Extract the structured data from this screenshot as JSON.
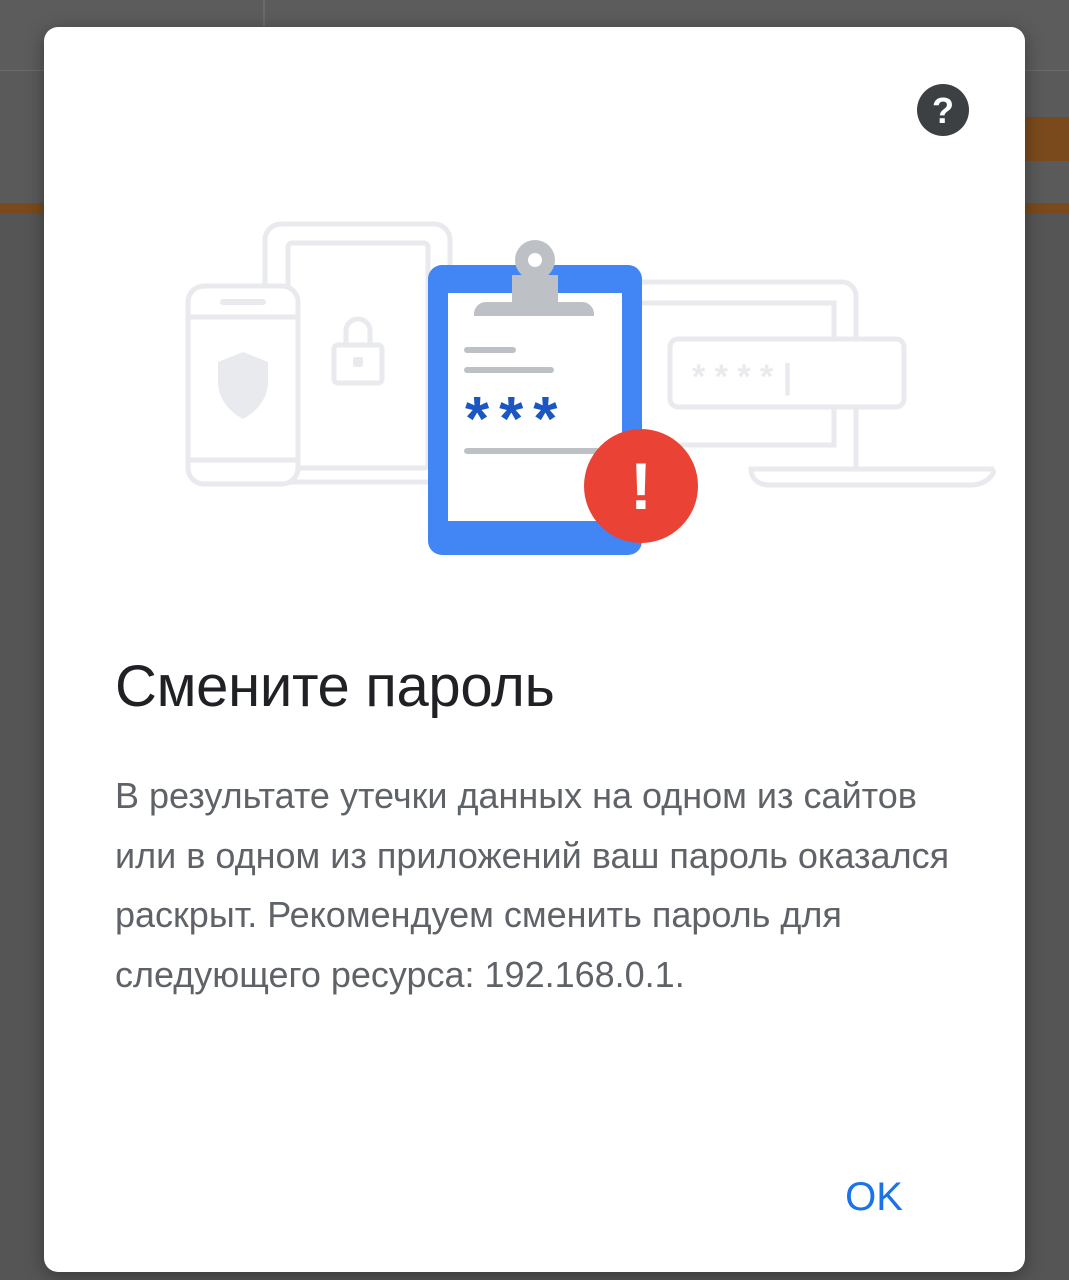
{
  "dialog": {
    "title": "Смените пароль",
    "message": "В результате утечки данных на одном из сайтов или в одном из приложений ваш пароль оказался раскрыт. Рекомендуем сменить пароль для следующего ресурса: 192.168.0.1.",
    "ok_label": "OK",
    "help_icon": "help-icon",
    "illustration": {
      "password_mask": "* * * * |",
      "clipboard_mask": "***",
      "alert_glyph": "!"
    }
  },
  "colors": {
    "accent_blue": "#1a73e8",
    "clipboard_blue": "#4285f4",
    "asterisk_blue": "#1a56c4",
    "alert_red": "#ea4335",
    "title_text": "#202124",
    "body_text": "#5f6368",
    "help_button_bg": "#3c4043",
    "illustration_gray": "#e8eaed"
  }
}
